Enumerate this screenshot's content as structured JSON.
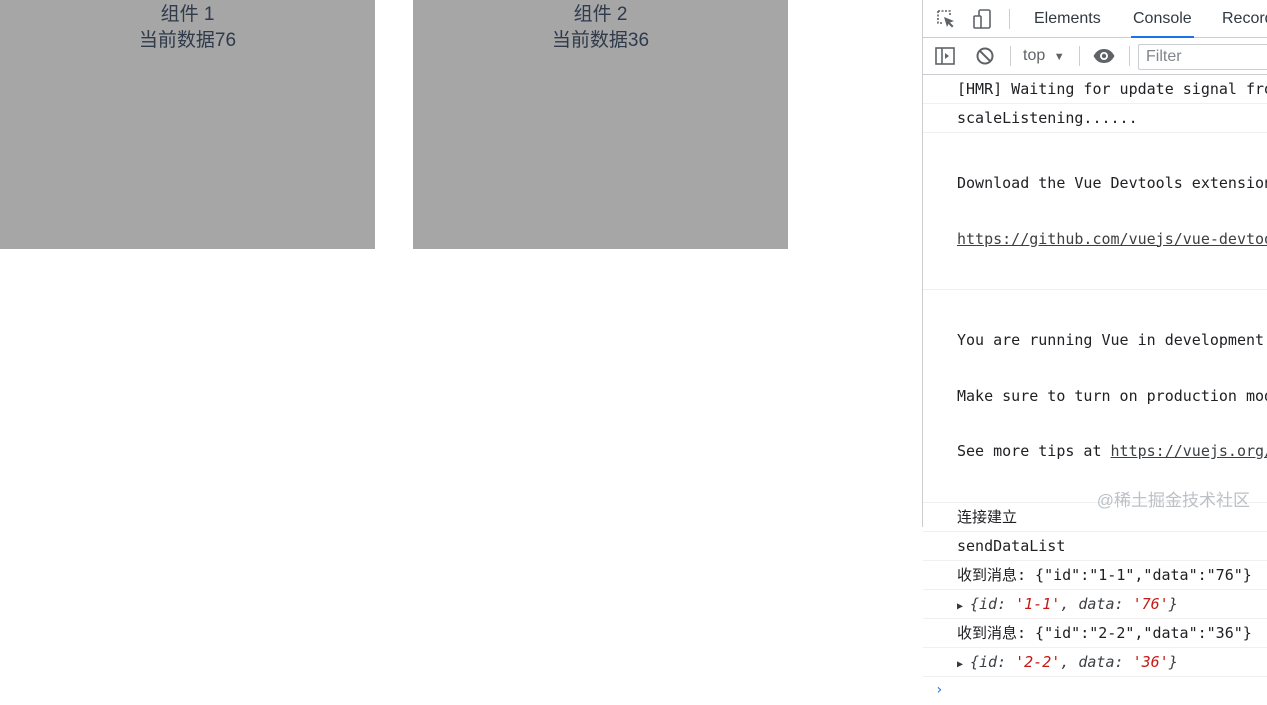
{
  "page": {
    "components": [
      {
        "title": "组件 1",
        "subtitle": "当前数据76"
      },
      {
        "title": "组件 2",
        "subtitle": "当前数据36"
      }
    ]
  },
  "devtools": {
    "tabs": [
      "Elements",
      "Console",
      "Record"
    ],
    "active_tab": "Console",
    "toolbar": {
      "context": "top",
      "filter_placeholder": "Filter"
    },
    "console": {
      "hmr": "[HMR] Waiting for update signal from",
      "scale": "scaleListening......",
      "devtools_1": "Download the Vue Devtools extension",
      "devtools_link": "https://github.com/vuejs/vue-devtools",
      "dev_1": "You are running Vue in development",
      "dev_2": "Make sure to turn on production mode",
      "dev_3_prefix": "See more tips at ",
      "dev_3_link": "https://vuejs.org/",
      "conn": "连接建立",
      "send": "sendDataList",
      "msg1": "收到消息: {\"id\":\"1-1\",\"data\":\"76\"}",
      "obj1": {
        "open": "{id: ",
        "id": "'1-1'",
        "mid": ", data: ",
        "data": "'76'",
        "close": "}"
      },
      "msg2": "收到消息: {\"id\":\"2-2\",\"data\":\"36\"}",
      "obj2": {
        "open": "{id: ",
        "id": "'2-2'",
        "mid": ", data: ",
        "data": "'36'",
        "close": "}"
      },
      "prompt": "›"
    }
  },
  "watermark": "@稀土掘金技术社区",
  "colors": {
    "panel": "#a6a6a6",
    "accent": "#1a73e8",
    "string": "#c41a16"
  }
}
